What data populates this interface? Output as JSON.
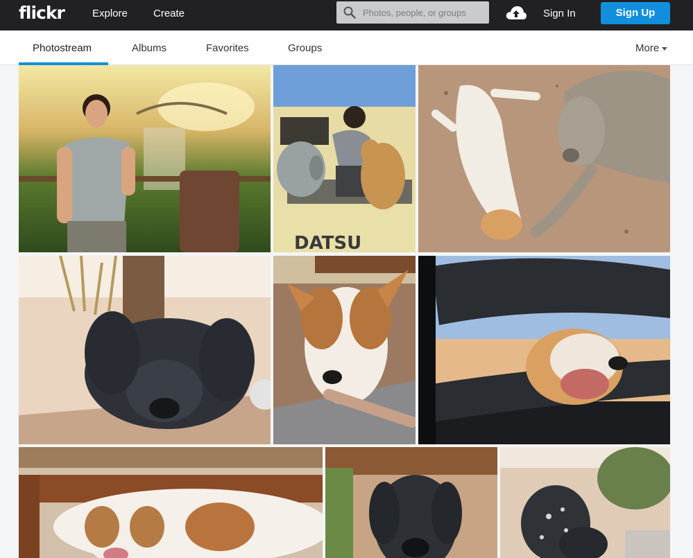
{
  "header": {
    "logo": "flickr",
    "nav": [
      "Explore",
      "Create"
    ],
    "search_placeholder": "Photos, people, or groups",
    "signin": "Sign In",
    "signup": "Sign Up"
  },
  "tabs": [
    "Photostream",
    "Albums",
    "Favorites",
    "Groups"
  ],
  "more": "More",
  "colors": {
    "topbar": "#212124",
    "accent": "#128fdc"
  },
  "icons": {
    "search": "search-icon",
    "upload": "cloud-upload-icon",
    "more": "caret-down-icon"
  }
}
